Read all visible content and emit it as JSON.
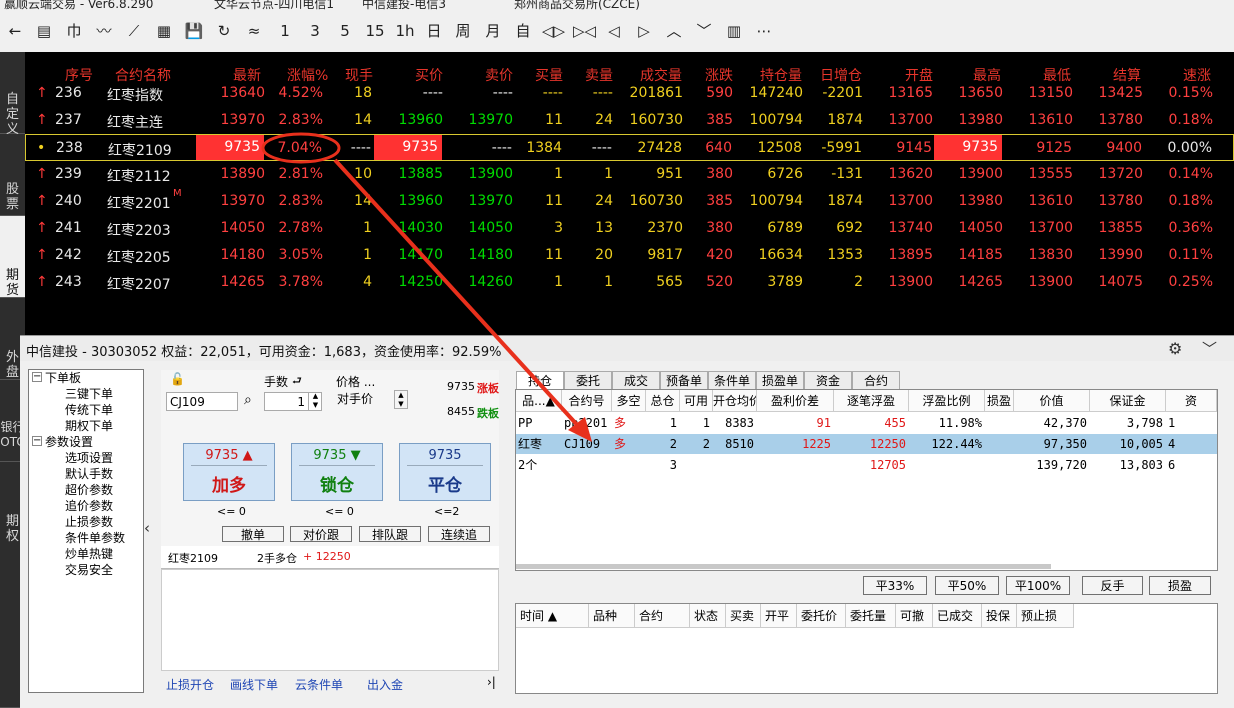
{
  "titlebar": {
    "app": "赢顺云端交易  -  Ver6.8.290",
    "server1": "文华云节点-四川电信1",
    "server2": "中信建投-电信3",
    "exchange": "郑州商品交易所(CZCE)"
  },
  "toolbar": {
    "icons": [
      "back-arrow",
      "list",
      "candle-hollow",
      "line",
      "tick",
      "grid-box",
      "save",
      "refresh",
      "zigzag",
      "period-1",
      "period-3",
      "period-5",
      "period-15",
      "period-1h",
      "day",
      "week",
      "month",
      "custom",
      "expand",
      "collapse",
      "left",
      "right",
      "up",
      "down",
      "panel",
      "more"
    ],
    "labels": [
      "←",
      "▤",
      "巾",
      "〰",
      "⟋",
      "▦",
      "💾",
      "↻",
      "≈",
      "1",
      "3",
      "5",
      "15",
      "1h",
      "日",
      "周",
      "月",
      "自",
      "◁▷",
      "▷◁",
      "◁",
      "▷",
      "︿",
      "﹀",
      "▥",
      "⋯"
    ]
  },
  "left_tabs": [
    "自定义",
    "股票",
    "期货",
    "外盘",
    "银行OTC",
    "期权"
  ],
  "grid": {
    "headers": [
      "序号",
      "合约名称",
      "最新",
      "涨幅%",
      "现手",
      "买价",
      "卖价",
      "买量",
      "卖量",
      "成交量",
      "涨跌",
      "持仓量",
      "日增仓",
      "开盘",
      "最高",
      "最低",
      "结算",
      "速涨"
    ],
    "rows": [
      {
        "no": "236",
        "name": "红枣指数",
        "mark": "",
        "last": "13640",
        "chg": "4.52%",
        "vol": "18",
        "bid": "----",
        "ask": "----",
        "bv": "----",
        "av": "----",
        "turn": "201861",
        "diff": "590",
        "oi": "147240",
        "doi": "-2201",
        "open": "13165",
        "high": "13650",
        "low": "13150",
        "settle": "13425",
        "speed": "0.15%"
      },
      {
        "no": "237",
        "name": "红枣主连",
        "mark": "",
        "last": "13970",
        "chg": "2.83%",
        "vol": "14",
        "bid": "13960",
        "ask": "13970",
        "bv": "11",
        "av": "24",
        "turn": "160730",
        "diff": "385",
        "oi": "100794",
        "doi": "1874",
        "open": "13700",
        "high": "13980",
        "low": "13610",
        "settle": "13780",
        "speed": "0.18%"
      },
      {
        "no": "238",
        "name": "红枣2109",
        "mark": "",
        "last": "9735",
        "chg": "7.04%",
        "vol": "----",
        "bid": "9735",
        "ask": "----",
        "bv": "1384",
        "av": "----",
        "turn": "27428",
        "diff": "640",
        "oi": "12508",
        "doi": "-5991",
        "open": "9145",
        "high": "9735",
        "low": "9125",
        "settle": "9400",
        "speed": "0.00%"
      },
      {
        "no": "239",
        "name": "红枣2112",
        "mark": "",
        "last": "13890",
        "chg": "2.81%",
        "vol": "10",
        "bid": "13885",
        "ask": "13900",
        "bv": "1",
        "av": "1",
        "turn": "951",
        "diff": "380",
        "oi": "6726",
        "doi": "-131",
        "open": "13620",
        "high": "13900",
        "low": "13555",
        "settle": "13720",
        "speed": "0.14%"
      },
      {
        "no": "240",
        "name": "红枣2201",
        "mark": "M",
        "last": "13970",
        "chg": "2.83%",
        "vol": "14",
        "bid": "13960",
        "ask": "13970",
        "bv": "11",
        "av": "24",
        "turn": "160730",
        "diff": "385",
        "oi": "100794",
        "doi": "1874",
        "open": "13700",
        "high": "13980",
        "low": "13610",
        "settle": "13780",
        "speed": "0.18%"
      },
      {
        "no": "241",
        "name": "红枣2203",
        "mark": "",
        "last": "14050",
        "chg": "2.78%",
        "vol": "1",
        "bid": "14030",
        "ask": "14050",
        "bv": "3",
        "av": "13",
        "turn": "2370",
        "diff": "380",
        "oi": "6789",
        "doi": "692",
        "open": "13740",
        "high": "14050",
        "low": "13700",
        "settle": "13855",
        "speed": "0.36%"
      },
      {
        "no": "242",
        "name": "红枣2205",
        "mark": "",
        "last": "14180",
        "chg": "3.05%",
        "vol": "1",
        "bid": "14170",
        "ask": "14180",
        "bv": "11",
        "av": "20",
        "turn": "9817",
        "diff": "420",
        "oi": "16634",
        "doi": "1353",
        "open": "13895",
        "high": "14185",
        "low": "13830",
        "settle": "13990",
        "speed": "0.11%"
      },
      {
        "no": "243",
        "name": "红枣2207",
        "mark": "",
        "last": "14265",
        "chg": "3.78%",
        "vol": "4",
        "bid": "14250",
        "ask": "14260",
        "bv": "1",
        "av": "1",
        "turn": "565",
        "diff": "520",
        "oi": "3789",
        "doi": "2",
        "open": "13900",
        "high": "14265",
        "low": "13900",
        "settle": "14075",
        "speed": "0.25%"
      }
    ]
  },
  "account": {
    "summary": "中信建投 - 30303052  权益：22,051，可用资金：1,683，资金使用率：92.59%"
  },
  "tree": {
    "group1": "下单板",
    "g1_items": [
      "三键下单",
      "传统下单",
      "期权下单"
    ],
    "group2": "参数设置",
    "g2_items": [
      "选项设置",
      "默认手数",
      "超价参数",
      "追价参数",
      "止损参数",
      "条件单参数",
      "炒单热键",
      "交易安全"
    ]
  },
  "order": {
    "contract": "CJ109",
    "qty_label": "手数",
    "qty": "1",
    "price_label": "价格 ...",
    "price_mode": "对手价",
    "limit_up_price": "9735",
    "limit_up_label": "涨板",
    "limit_down_price": "8455",
    "limit_down_label": "跌板",
    "buttons": [
      {
        "price": "9735 ▲",
        "label": "加多",
        "under": "<= 0"
      },
      {
        "price": "9735 ▼",
        "label": "锁仓",
        "under": "<= 0"
      },
      {
        "price": "9735",
        "label": "平仓",
        "under": "<=2"
      }
    ],
    "small_buttons": [
      "撤单",
      "对价跟",
      "排队跟",
      "连续追"
    ],
    "pos_contract": "红枣2109",
    "pos_desc": "2手多仓",
    "pos_pnl": "+ 12250"
  },
  "bottom_links": [
    "止损开仓",
    "画线下单",
    "云条件单",
    "出入金"
  ],
  "tabs": [
    "持仓",
    "委托",
    "成交",
    "预备单",
    "条件单",
    "损盈单",
    "资金",
    "合约"
  ],
  "positions": {
    "headers": [
      "品...▲",
      "合约号",
      "多空",
      "总仓",
      "可用",
      "开仓均价",
      "盈利价差",
      "逐笔浮盈",
      "浮盈比例",
      "损盈",
      "价值",
      "保证金",
      "资"
    ],
    "rows": [
      [
        "PP",
        "pp2201",
        "多",
        "1",
        "1",
        "8383",
        "91",
        "455",
        "11.98%",
        "",
        "42,370",
        "3,798",
        "1"
      ],
      [
        "红枣",
        "CJ109",
        "多",
        "2",
        "2",
        "8510",
        "1225",
        "12250",
        "122.44%",
        "",
        "97,350",
        "10,005",
        "4"
      ],
      [
        "2个",
        "",
        "",
        "3",
        "",
        "",
        "",
        "12705",
        "",
        "",
        "139,720",
        "13,803",
        "6"
      ]
    ]
  },
  "pos_buttons": [
    "平33%",
    "平50%",
    "平100%",
    "反手",
    "损盈"
  ],
  "orders": {
    "headers": [
      "时间 ▲",
      "品种",
      "合约",
      "状态",
      "买卖",
      "开平",
      "委托价",
      "委托量",
      "可撤",
      "已成交",
      "投保",
      "预止损"
    ]
  },
  "colors": {
    "up": "#ff4040",
    "down": "#00dc00",
    "highlight": "#ff3232",
    "header": "#e6352b",
    "arrow": "#e8301c",
    "selected_row": "#a9cfe9"
  }
}
